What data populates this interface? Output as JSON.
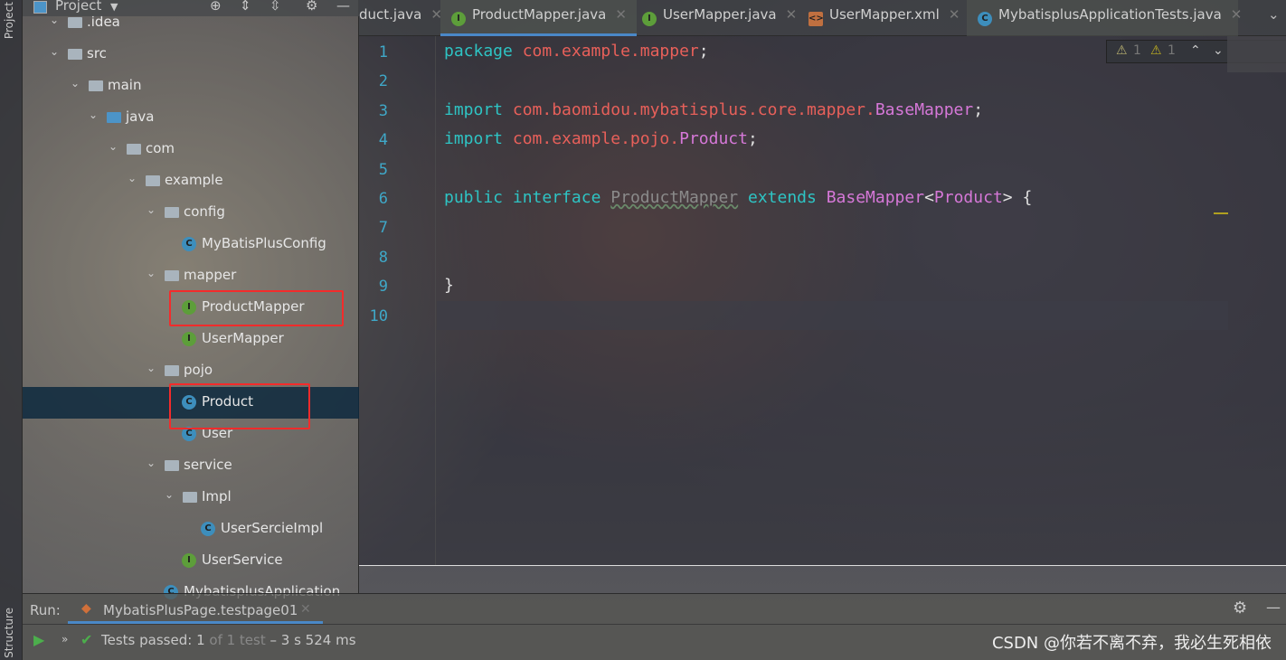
{
  "left_strip": {
    "project": "Project",
    "structure": "Structure"
  },
  "project_panel": {
    "title": "Project",
    "tree": [
      {
        "label": ".idea",
        "kind": "folder",
        "depth": 0
      },
      {
        "label": "src",
        "kind": "folder",
        "depth": 0
      },
      {
        "label": "main",
        "kind": "folder",
        "depth": 1
      },
      {
        "label": "java",
        "kind": "folder-blue",
        "depth": 2
      },
      {
        "label": "com",
        "kind": "folder",
        "depth": 3
      },
      {
        "label": "example",
        "kind": "folder",
        "depth": 4
      },
      {
        "label": "config",
        "kind": "folder",
        "depth": 5
      },
      {
        "label": "MyBatisPlusConfig",
        "kind": "class",
        "depth": 6
      },
      {
        "label": "mapper",
        "kind": "folder",
        "depth": 5
      },
      {
        "label": "ProductMapper",
        "kind": "interface",
        "depth": 6,
        "highlighted": true
      },
      {
        "label": "UserMapper",
        "kind": "interface",
        "depth": 6
      },
      {
        "label": "pojo",
        "kind": "folder",
        "depth": 5
      },
      {
        "label": "Product",
        "kind": "class",
        "depth": 6,
        "selected": true,
        "highlighted": true
      },
      {
        "label": "User",
        "kind": "class",
        "depth": 6
      },
      {
        "label": "service",
        "kind": "folder",
        "depth": 5
      },
      {
        "label": "Impl",
        "kind": "folder",
        "depth": 6
      },
      {
        "label": "UserSercieImpl",
        "kind": "class",
        "depth": 7
      },
      {
        "label": "UserService",
        "kind": "interface",
        "depth": 6
      },
      {
        "label": "MybatisplusApplication",
        "kind": "class",
        "depth": 5
      }
    ]
  },
  "tabs": [
    {
      "label": "duct.java"
    },
    {
      "label": "ProductMapper.java",
      "icon": "interface",
      "active": true
    },
    {
      "label": "UserMapper.java",
      "icon": "interface"
    },
    {
      "label": "UserMapper.xml",
      "icon": "xml"
    },
    {
      "label": "MybatisplusApplicationTests.java",
      "icon": "class"
    }
  ],
  "inspections": {
    "warnings": "1",
    "weak_warnings": "1"
  },
  "code_lines": [
    "1",
    "2",
    "3",
    "4",
    "5",
    "6",
    "7",
    "8",
    "9",
    "10"
  ],
  "code": {
    "l1": {
      "kw": "package",
      "pk": "com.example.mapper",
      ";": ";"
    },
    "l3": {
      "kw": "import",
      "pk": "com.baomidou.mybatisplus.core.mapper.",
      "ty": "BaseMapper"
    },
    "l4": {
      "kw": "import",
      "pk": "com.example.pojo.",
      "ty": "Product"
    },
    "l6": {
      "kw1": "public",
      "kw2": "interface",
      "name": "ProductMapper",
      "kw3": "extends",
      "base": "BaseMapper",
      "gen": "Product",
      "open": "{"
    },
    "l9": "}"
  },
  "run": {
    "label": "Run:",
    "config": "MybatisPlusPage.testpage01",
    "status": "Tests passed:",
    "passed": "1",
    "of": "of 1 test",
    "time": "– 3 s 524 ms"
  },
  "watermark": "CSDN @你若不离不弃，我必生死相依",
  "colors": {
    "highlight": "#f42b2b",
    "keyword": "#2ec4c4",
    "package": "#e8605a",
    "type": "#d678d8"
  }
}
